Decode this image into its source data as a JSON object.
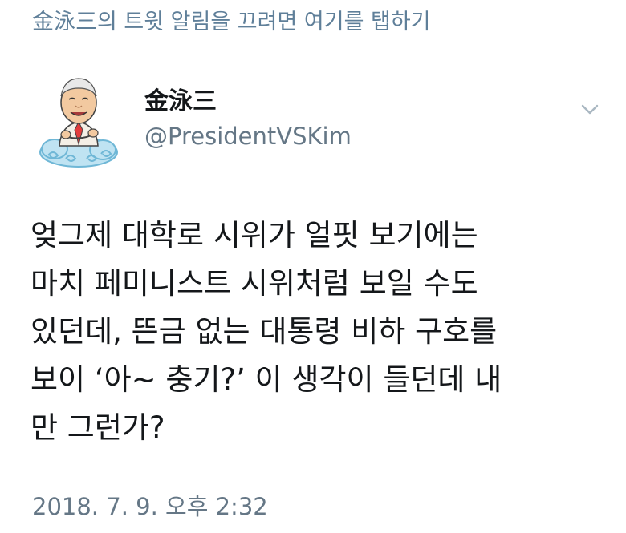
{
  "notification_bar": {
    "text": "金泳三의 트윗 알림을 끄려면 여기를 탭하기"
  },
  "author": {
    "display_name": "金泳三",
    "handle": "@PresidentVSKim"
  },
  "tweet": {
    "lines": [
      "엊그제 대학로 시위가 얼핏 보기에는",
      "마치 페미니스트 시위처럼 보일 수도",
      "있던데, 뜬금 없는 대통령 비하 구호를",
      "보이 ‘아~ 충기?’ 이 생각이 들던데 내",
      "만 그런가?"
    ],
    "timestamp": "2018. 7. 9. 오후 2:32"
  },
  "icons": {
    "more_options": "chevron-down-icon",
    "avatar": "cartoon-avatar-on-cloud"
  },
  "colors": {
    "notification_text": "#5f7f99",
    "secondary_text": "#657786",
    "primary_text": "#14171a",
    "chevron": "#aab8c2",
    "cloud_fill": "#bfe3f2",
    "cloud_stroke": "#6fb7d6"
  }
}
